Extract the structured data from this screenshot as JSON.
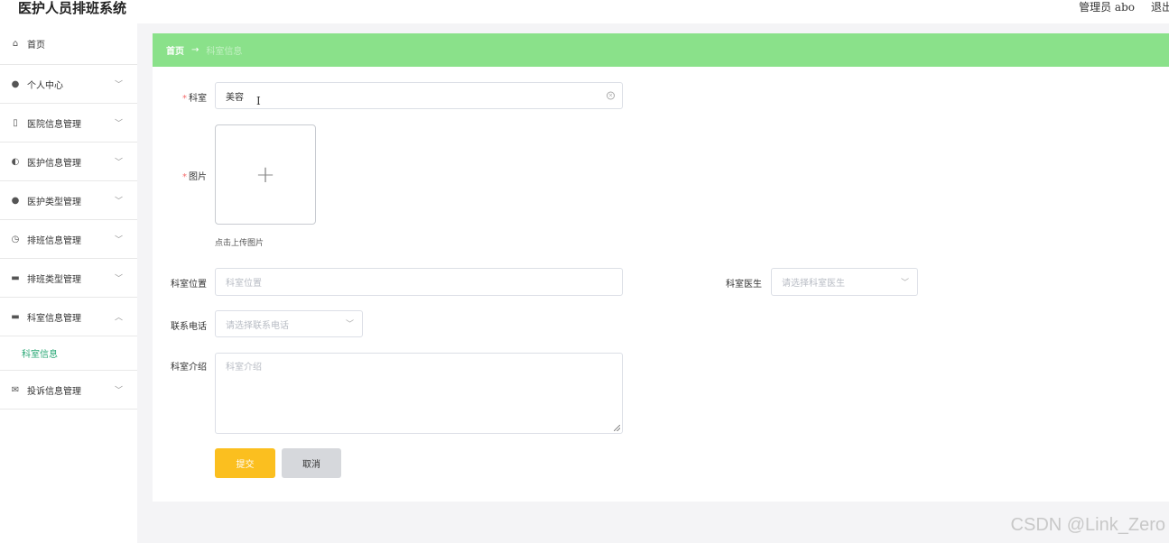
{
  "app": {
    "title": "医护人员排班系统"
  },
  "header": {
    "user": "管理员 abo",
    "logout": "退出"
  },
  "sidebar": {
    "items": [
      {
        "label": "首页",
        "icon": "home-icon",
        "glyph": "⌂"
      },
      {
        "label": "个人中心",
        "icon": "user-icon",
        "glyph": "●",
        "chevron": "﹀"
      },
      {
        "label": "医院信息管理",
        "icon": "phone-icon",
        "glyph": "▯",
        "chevron": "﹀"
      },
      {
        "label": "医护信息管理",
        "icon": "microphone-icon",
        "glyph": "◐",
        "chevron": "﹀"
      },
      {
        "label": "医护类型管理",
        "icon": "balloon-icon",
        "glyph": "●",
        "chevron": "﹀"
      },
      {
        "label": "排班信息管理",
        "icon": "clock-icon",
        "glyph": "◷",
        "chevron": "﹀"
      },
      {
        "label": "排班类型管理",
        "icon": "box-icon",
        "glyph": "▬",
        "chevron": "﹀"
      },
      {
        "label": "科室信息管理",
        "icon": "chat-icon",
        "glyph": "▬",
        "chevron": "︿"
      },
      {
        "label": "投诉信息管理",
        "icon": "mail-icon",
        "glyph": "✉",
        "chevron": "﹀"
      }
    ],
    "sub_item": "科室信息"
  },
  "breadcrumb": {
    "home": "首页",
    "arrow": "→",
    "current": "科室信息"
  },
  "form": {
    "dept_label": "科室",
    "dept_value": "美容",
    "image_label": "图片",
    "upload_plus": "+",
    "upload_hint": "点击上传图片",
    "location_label": "科室位置",
    "location_placeholder": "科室位置",
    "doctor_label": "科室医生",
    "doctor_placeholder": "请选择科室医生",
    "phone_label": "联系电话",
    "phone_placeholder": "请选择联系电话",
    "intro_label": "科室介绍",
    "intro_placeholder": "科室介绍",
    "required_mark": "*",
    "clear_glyph": "×",
    "select_chevron": "﹀",
    "ibeam": "I"
  },
  "buttons": {
    "submit": "提交",
    "cancel": "取消"
  },
  "watermark": "CSDN @Link_Zero",
  "colors": {
    "breadcrumb_bg": "#8ae18a",
    "submit_bg": "#fbbf1f",
    "active_sub": "#2aa876",
    "required": "#f56c6c"
  }
}
